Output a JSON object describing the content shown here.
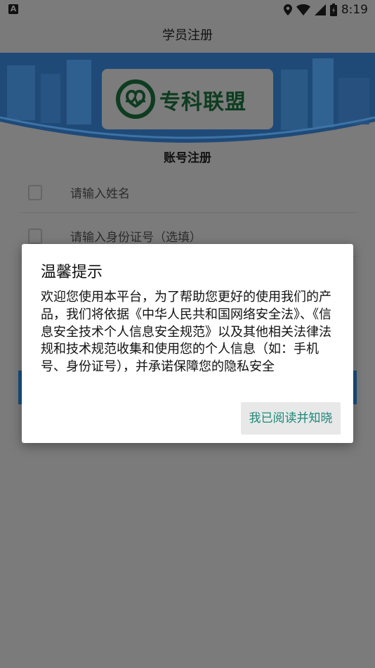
{
  "statusbar": {
    "time": "8:19",
    "app_badge": "A"
  },
  "header": {
    "title": "学员注册"
  },
  "banner": {
    "logo_text": "专科联盟"
  },
  "form": {
    "title": "账号注册",
    "name_placeholder": "请输入姓名",
    "id_placeholder": "请输入身份证号（选填）"
  },
  "dialog": {
    "title": "温馨提示",
    "body": "欢迎您使用本平台，为了帮助您更好的使用我们的产品，我们将依据《中华人民共和国网络安全法》、《信息安全技术个人信息安全规范》以及其他相关法律法规和技术规范收集和使用您的个人信息（如：手机号、身份证号），并承诺保障您的隐私安全",
    "confirm_label": "我已阅读并知晓"
  },
  "colors": {
    "accent": "#1a8a7a",
    "overlay": "#7b7b7b"
  }
}
